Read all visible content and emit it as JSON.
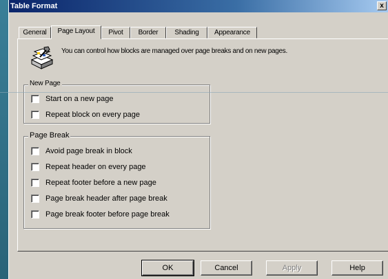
{
  "window": {
    "title": "Table Format",
    "close_glyph": "x"
  },
  "tabs": [
    {
      "label": "General",
      "active": false
    },
    {
      "label": "Page Layout",
      "active": true
    },
    {
      "label": "Pivot",
      "active": false
    },
    {
      "label": "Border",
      "active": false
    },
    {
      "label": "Shading",
      "active": false
    },
    {
      "label": "Appearance",
      "active": false
    }
  ],
  "info": {
    "icon": "wrench-blocks-icon",
    "text": "You can control how blocks are managed over page breaks and on new pages."
  },
  "new_page_group": {
    "legend": "New Page",
    "options": [
      {
        "label": "Start on a new page",
        "checked": false
      },
      {
        "label": "Repeat block on every page",
        "checked": false
      }
    ]
  },
  "page_break_group": {
    "legend": "Page Break",
    "options": [
      {
        "label": "Avoid page break in block",
        "checked": false
      },
      {
        "label": "Repeat header on every page",
        "checked": false
      },
      {
        "label": "Repeat footer before a new page",
        "checked": false
      },
      {
        "label": "Page break header after page break",
        "checked": false
      },
      {
        "label": "Page break footer before page break",
        "checked": false
      }
    ]
  },
  "buttons": {
    "ok": "OK",
    "cancel": "Cancel",
    "apply": "Apply",
    "help": "Help"
  },
  "colors": {
    "dialog_face": "#d4d0c8",
    "title_gradient_start": "#0a246a",
    "desktop": "#2e6f86"
  }
}
